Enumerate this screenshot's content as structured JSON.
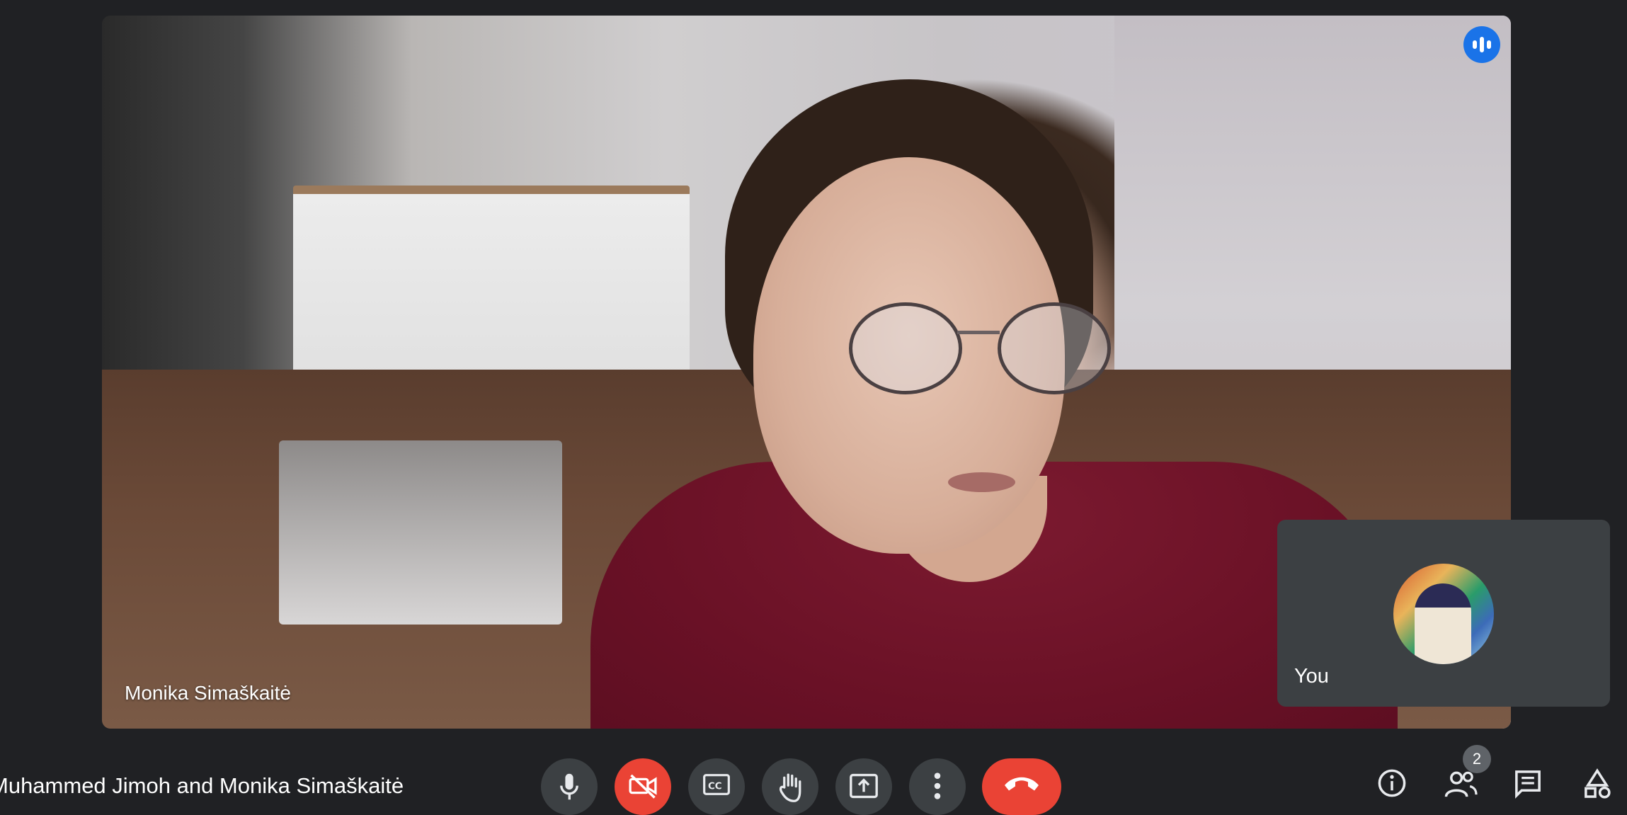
{
  "main_video": {
    "participant_name": "Monika Simaškaitė",
    "speaking_indicator_icon": "audio-bars-icon"
  },
  "self_view": {
    "label": "You"
  },
  "meeting": {
    "title": "Muhammed Jimoh and Monika Simaškaitė"
  },
  "controls": [
    {
      "name": "microphone",
      "icon": "mic-icon",
      "state": "on"
    },
    {
      "name": "camera",
      "icon": "video-off-icon",
      "state": "off"
    },
    {
      "name": "captions",
      "icon": "cc-icon"
    },
    {
      "name": "raise-hand",
      "icon": "hand-icon"
    },
    {
      "name": "present",
      "icon": "present-screen-icon"
    },
    {
      "name": "more-options",
      "icon": "more-vert-icon"
    },
    {
      "name": "leave-call",
      "icon": "call-end-icon"
    }
  ],
  "side_controls": {
    "people_count": "2"
  },
  "colors": {
    "background": "#202124",
    "tile": "#3c4043",
    "danger": "#ea4335",
    "accent": "#1a73e8"
  }
}
